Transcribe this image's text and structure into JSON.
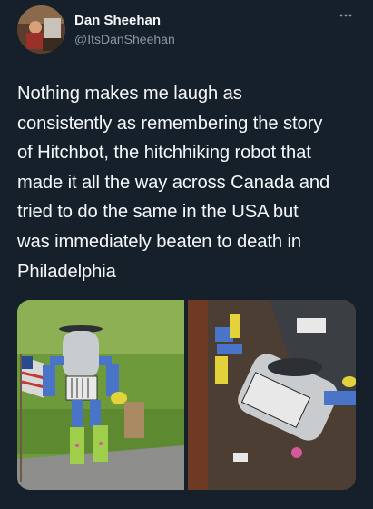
{
  "author": {
    "display_name": "Dan Sheehan",
    "handle": "@ItsDanSheehan",
    "avatar_icon": "profile-photo"
  },
  "tweet": {
    "lines": [
      "Nothing makes me laugh as",
      "consistently as remembering the story",
      "of Hitchbot, the hitchhiking robot that",
      "made it all the way across Canada and",
      "tried to do the same in the USA but",
      "was immediately beaten to death in",
      "Philadelphia"
    ]
  },
  "menu_icon": "more-horizontal-icon",
  "colors": {
    "background": "#15202b",
    "text": "#f5f8fa",
    "secondary": "#8899a6"
  }
}
